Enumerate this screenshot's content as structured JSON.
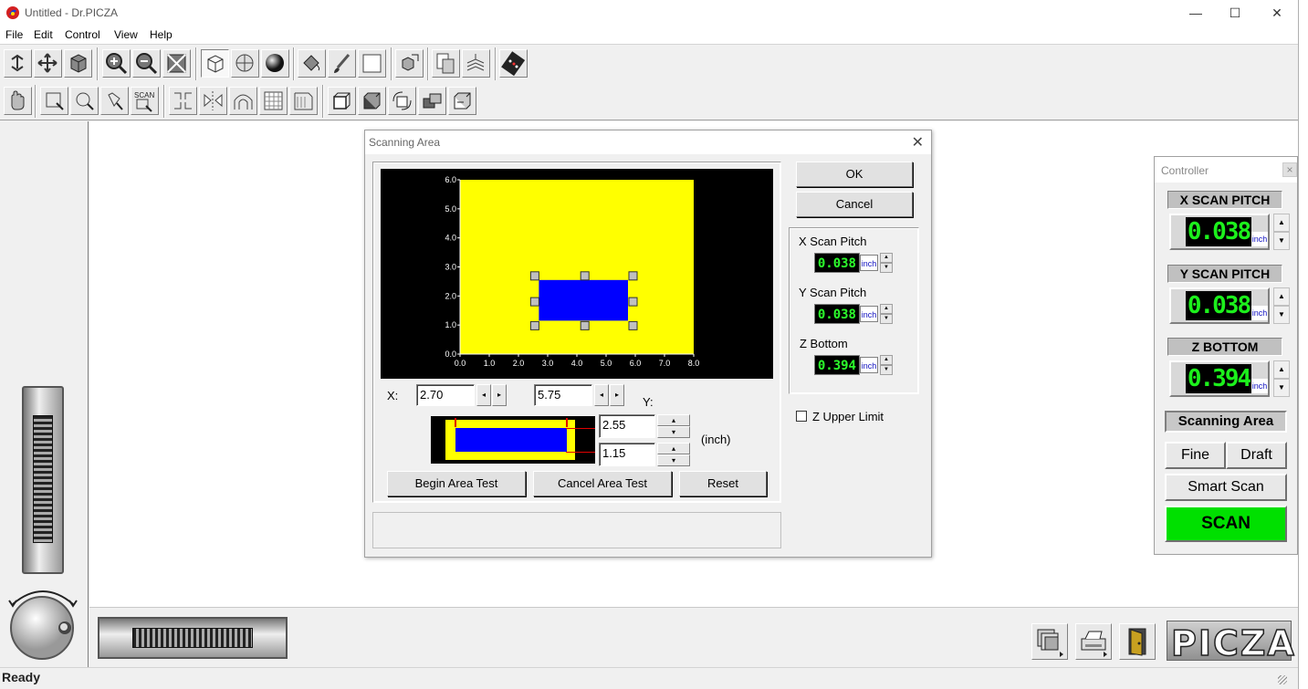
{
  "window": {
    "title": "Untitled - Dr.PICZA",
    "minimize": "—",
    "maximize": "☐",
    "close": "✕"
  },
  "menu": [
    "File",
    "Edit",
    "Control",
    "View",
    "Help"
  ],
  "status": {
    "text": "Ready"
  },
  "dialog": {
    "title": "Scanning Area",
    "close": "✕",
    "ok_label": "OK",
    "cancel_label": "Cancel",
    "x_label": "X:",
    "y_label": "Y:",
    "x_start": "2.70",
    "x_end": "5.75",
    "y_top": "2.55",
    "y_bottom": "1.15",
    "unit_label": "(inch)",
    "begin_test_label": "Begin Area Test",
    "cancel_test_label": "Cancel Area Test",
    "reset_label": "Reset",
    "x_pitch_label": "X Scan Pitch",
    "x_pitch_value": "0.038",
    "y_pitch_label": "Y Scan Pitch",
    "y_pitch_value": "0.038",
    "z_bottom_label": "Z Bottom",
    "z_bottom_value": "0.394",
    "lcd_unit": "inch",
    "z_upper_label": "Z Upper Limit",
    "z_upper_checked": false,
    "preview": {
      "x_ticks": [
        "0.0",
        "1.0",
        "2.0",
        "3.0",
        "4.0",
        "5.0",
        "6.0",
        "7.0",
        "8.0"
      ],
      "y_ticks": [
        "6.0",
        "5.0",
        "4.0",
        "3.0",
        "2.0",
        "1.0",
        "0.0"
      ],
      "bed_width": 8.0,
      "bed_height": 6.0,
      "area_x1": 2.7,
      "area_x2": 5.75,
      "area_y1": 1.15,
      "area_y2": 2.55,
      "bed_color": "#ffff00",
      "area_color": "#0000ff"
    }
  },
  "controller": {
    "title": "Controller",
    "close": "×",
    "x_pitch_label": "X SCAN PITCH",
    "x_pitch_value": "0.038",
    "y_pitch_label": "Y SCAN PITCH",
    "y_pitch_value": "0.038",
    "z_bottom_label": "Z BOTTOM",
    "z_bottom_value": "0.394",
    "unit": "inch",
    "scanning_area_label": "Scanning Area",
    "fine_label": "Fine",
    "draft_label": "Draft",
    "smart_scan_label": "Smart Scan",
    "scan_label": "SCAN",
    "scan_color": "#00e000"
  },
  "brand": {
    "logo_text": "PICZA"
  },
  "toolbar_icons_row1": [
    "rotate-icon",
    "move-icon",
    "cube-fill-icon",
    "zoom-in-icon",
    "zoom-out-icon",
    "fit-icon",
    "wireframe-icon",
    "flat-shade-icon",
    "smooth-shade-icon",
    "paint-bucket-icon",
    "brush-icon",
    "rectangle-icon",
    "cube-export-icon",
    "copy-page-icon",
    "scan-stack-icon",
    "controller-icon"
  ],
  "toolbar_icons_row2": [
    "hand-icon",
    "select-rect-icon",
    "select-circle-icon",
    "lasso-icon",
    "scan-select-icon",
    "resize-icon",
    "mirror-icon",
    "arch-icon",
    "grid-icon",
    "table-icon",
    "box-front-icon",
    "box-side-icon",
    "box-rotate-icon",
    "box-stack-icon",
    "box-flip-icon"
  ]
}
